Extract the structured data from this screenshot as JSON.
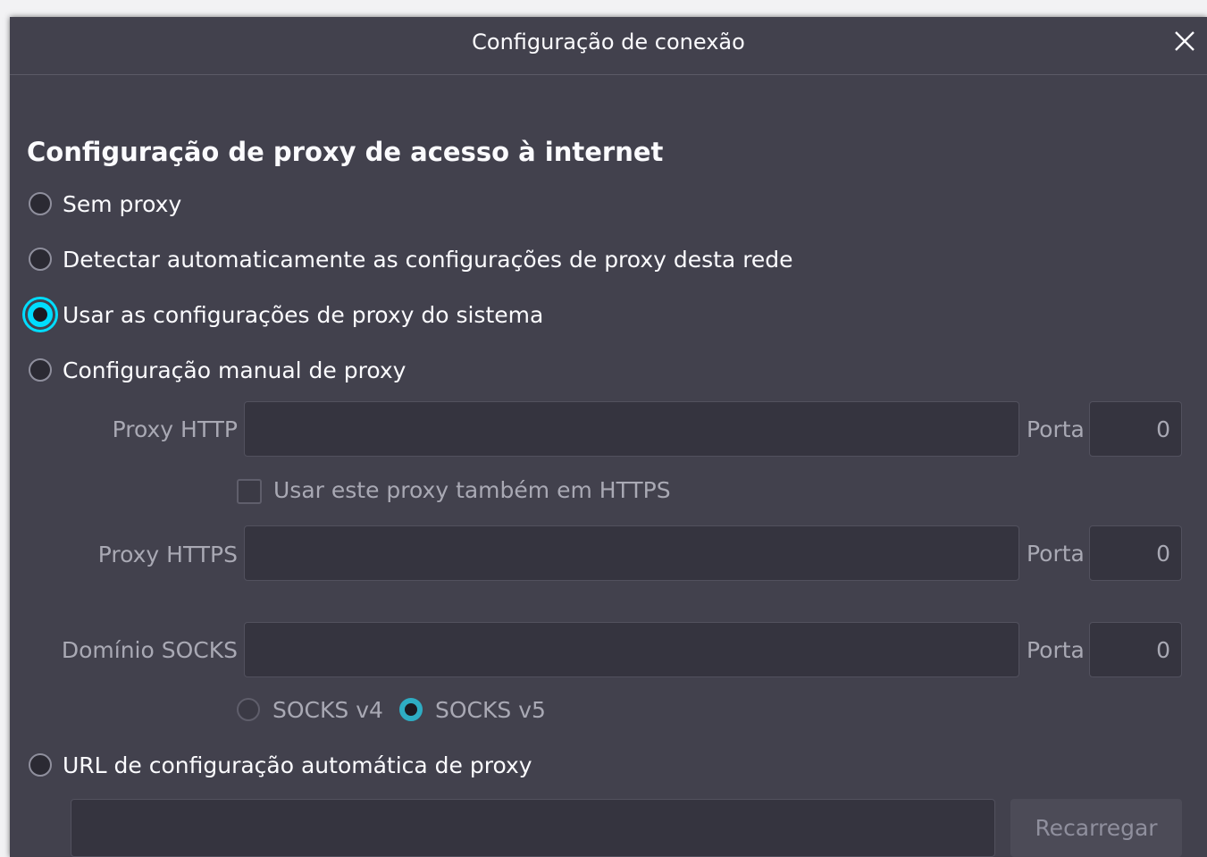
{
  "dialog": {
    "title": "Configuração de conexão",
    "close_icon": "close-icon"
  },
  "section": {
    "title": "Configuração de proxy de acesso à internet"
  },
  "options": {
    "no_proxy": "Sem proxy",
    "auto_detect": "Detectar automaticamente as configurações de proxy desta rede",
    "system": "Usar as configurações de proxy do sistema",
    "manual": "Configuração manual de proxy",
    "auto_url": "URL de configuração automática de proxy",
    "selected": "system"
  },
  "manual": {
    "http_label": "Proxy HTTP",
    "http_value": "",
    "port_label": "Porta",
    "http_port": "0",
    "also_https_label": "Usar este proxy também em HTTPS",
    "also_https_checked": false,
    "https_label": "Proxy HTTPS",
    "https_value": "",
    "https_port": "0",
    "socks_label": "Domínio SOCKS",
    "socks_value": "",
    "socks_port": "0",
    "socks_v4": "SOCKS v4",
    "socks_v5": "SOCKS v5",
    "socks_selected": "v5"
  },
  "auto_url": {
    "value": "",
    "reload_label": "Recarregar"
  },
  "colors": {
    "background": "#42414d",
    "accent": "#00ddff",
    "text": "#fbfbfe",
    "disabled_text": "#a9a9b4"
  }
}
